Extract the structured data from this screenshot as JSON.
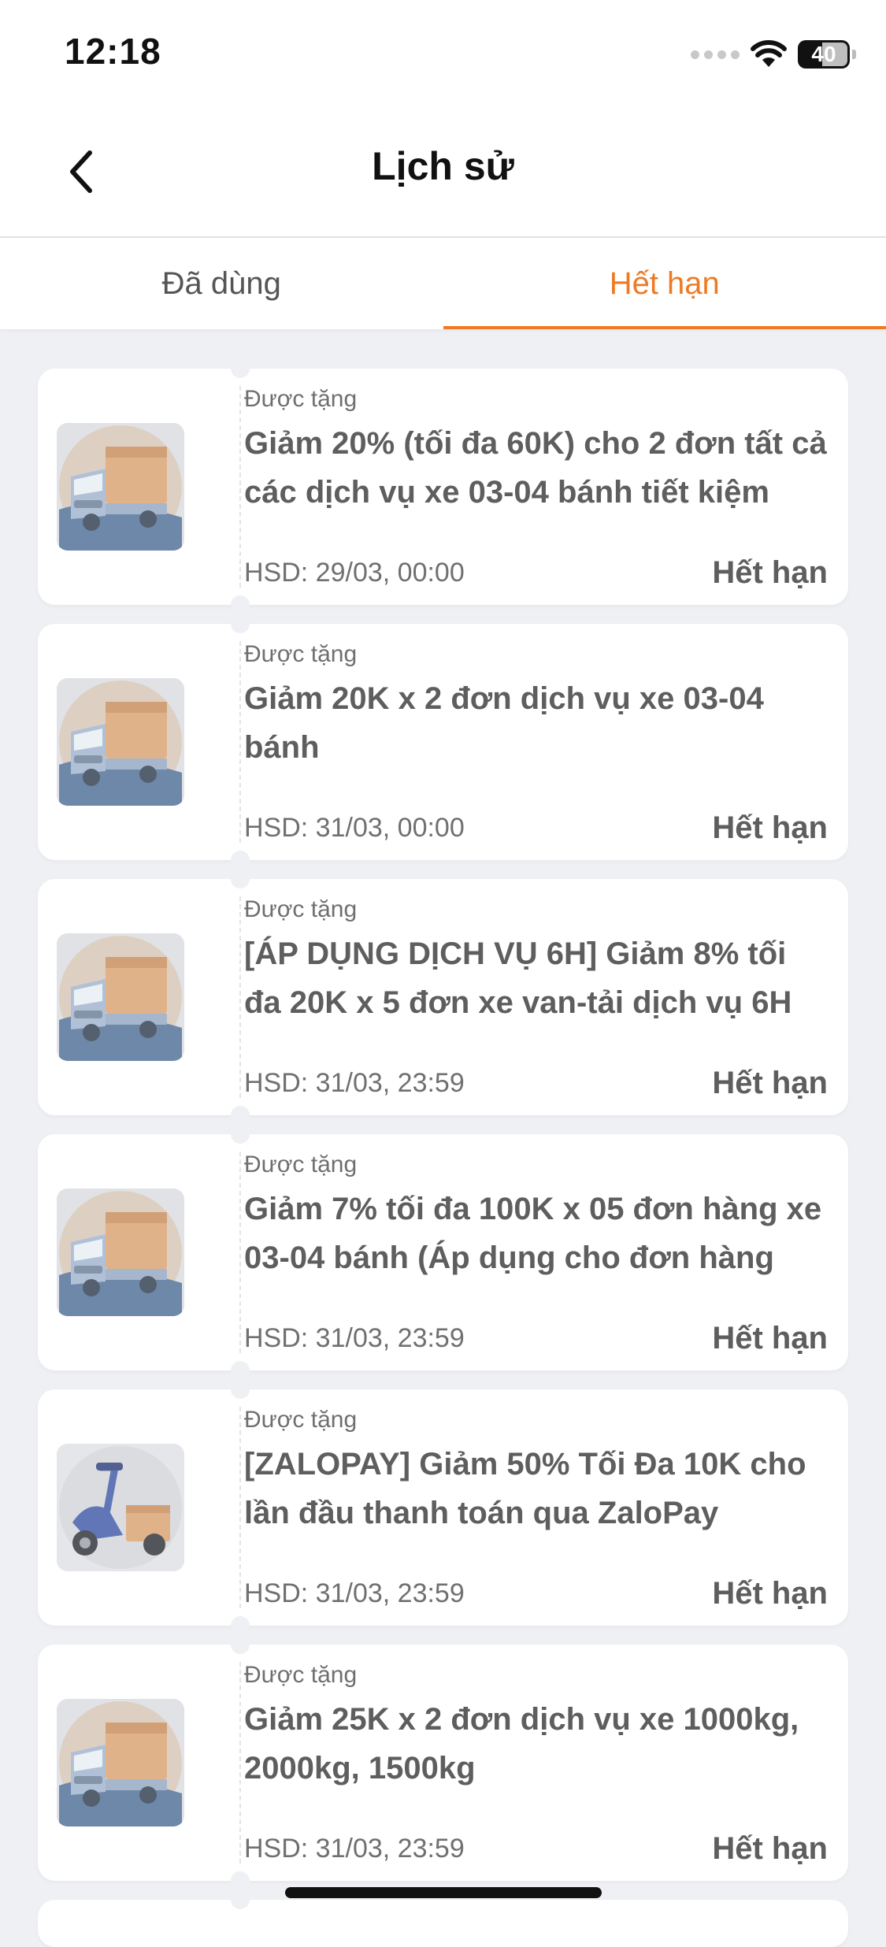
{
  "status_bar": {
    "time": "12:18",
    "battery": "40"
  },
  "header": {
    "title": "Lịch sử"
  },
  "tabs": [
    {
      "label": "Đã dùng",
      "active": false
    },
    {
      "label": "Hết hạn",
      "active": true
    }
  ],
  "colors": {
    "accent": "#ee7a24",
    "background": "#eef0f3"
  },
  "vouchers": [
    {
      "source": "Được tặng",
      "title": "Giảm 20% (tối đa 60K) cho 2 đơn tất cả các dịch vụ xe 03-04 bánh tiết kiệm",
      "expiry": "HSD: 29/03, 00:00",
      "status": "Hết hạn",
      "icon": "truck-icon"
    },
    {
      "source": "Được tặng",
      "title": "Giảm 20K x 2 đơn dịch vụ xe 03-04 bánh",
      "expiry": "HSD: 31/03, 00:00",
      "status": "Hết hạn",
      "icon": "truck-icon"
    },
    {
      "source": "Được tặng",
      "title": "[ÁP DỤNG DỊCH VỤ 6H]  Giảm 8% tối đa 20K x 5 đơn xe van-tải dịch vụ 6H",
      "expiry": "HSD: 31/03, 23:59",
      "status": "Hết hạn",
      "icon": "truck-icon"
    },
    {
      "source": "Được tặng",
      "title": "Giảm 7% tối đa 100K x 05 đơn hàng xe 03-04 bánh (Áp dụng  cho đơn hàng",
      "expiry": "HSD: 31/03, 23:59",
      "status": "Hết hạn",
      "icon": "truck-icon"
    },
    {
      "source": "Được tặng",
      "title": "[ZALOPAY] Giảm 50% Tối Đa 10K cho lần đầu thanh toán qua ZaloPay",
      "expiry": "HSD: 31/03, 23:59",
      "status": "Hết hạn",
      "icon": "scooter-icon"
    },
    {
      "source": "Được tặng",
      "title": "Giảm 25K x 2 đơn dịch vụ xe 1000kg, 2000kg, 1500kg",
      "expiry": "HSD: 31/03, 23:59",
      "status": "Hết hạn",
      "icon": "truck-icon"
    }
  ]
}
